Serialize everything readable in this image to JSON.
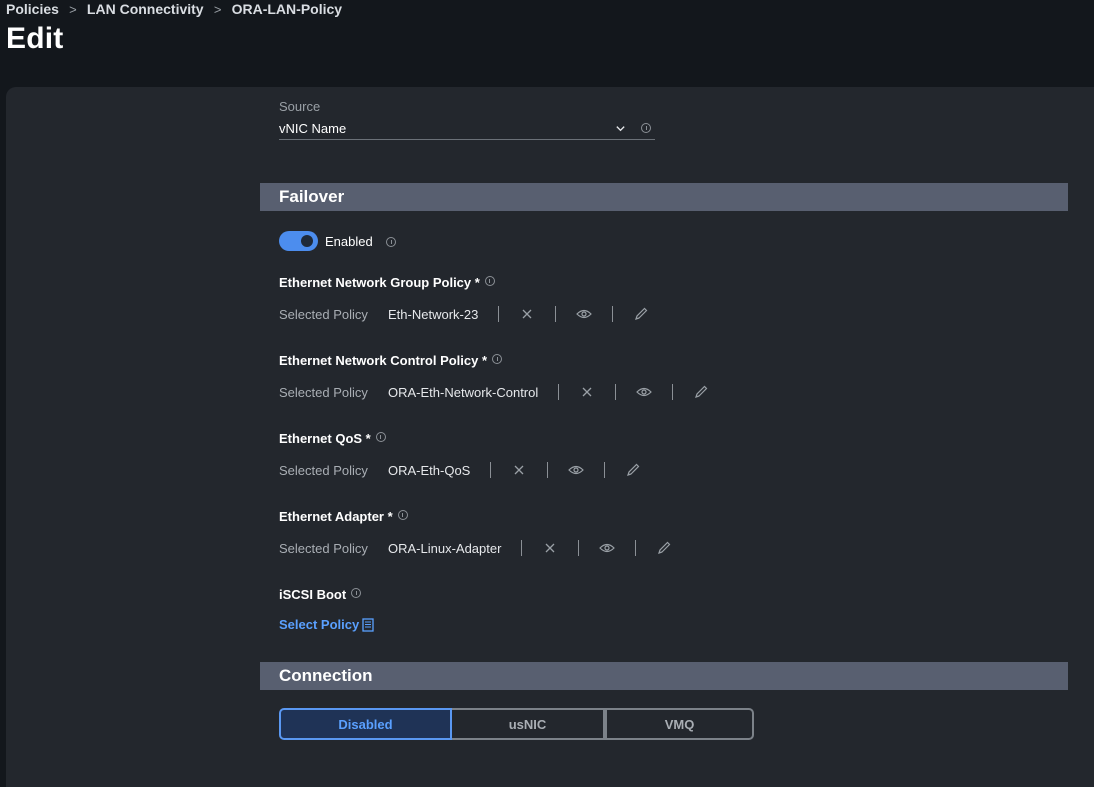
{
  "breadcrumb": {
    "items": [
      "Policies",
      "LAN Connectivity",
      "ORA-LAN-Policy"
    ]
  },
  "page": {
    "title": "Edit"
  },
  "source": {
    "label": "Source",
    "value": "vNIC Name"
  },
  "sections": {
    "failover": "Failover",
    "connection": "Connection"
  },
  "failover": {
    "enabled_label": "Enabled",
    "enabled": true
  },
  "policies": [
    {
      "title": "Ethernet Network Group Policy *",
      "selected_label": "Selected Policy",
      "value": "Eth-Network-23"
    },
    {
      "title": "Ethernet Network Control Policy *",
      "selected_label": "Selected Policy",
      "value": "ORA-Eth-Network-Control"
    },
    {
      "title": "Ethernet QoS *",
      "selected_label": "Selected Policy",
      "value": "ORA-Eth-QoS"
    },
    {
      "title": "Ethernet Adapter *",
      "selected_label": "Selected Policy",
      "value": "ORA-Linux-Adapter"
    }
  ],
  "iscsi": {
    "title": "iSCSI Boot",
    "select_label": "Select Policy"
  },
  "connection": {
    "options": [
      "Disabled",
      "usNIC",
      "VMQ"
    ],
    "selected": "Disabled"
  },
  "colors": {
    "accent": "#4c8dee",
    "link": "#5aa0ff",
    "section_header": "#585f70",
    "panel": "#23272d",
    "background": "#13171c"
  }
}
